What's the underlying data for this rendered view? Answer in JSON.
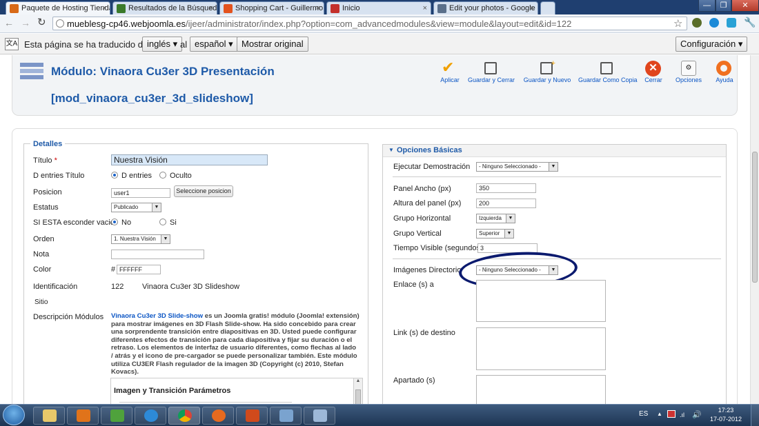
{
  "browser": {
    "tabs": [
      {
        "title": "Paquete de Hosting Tienda",
        "close": "×",
        "color": "#d86a18"
      },
      {
        "title": "Resultados de la Búsqueda",
        "close": "×",
        "color": "#3b7a2a"
      },
      {
        "title": "Shopping Cart - Guillermo",
        "close": "×",
        "color": "#e3531e"
      },
      {
        "title": "Inicio",
        "close": "×",
        "color": "#c4302b"
      },
      {
        "title": "Edit your photos - Google",
        "close": "×",
        "color": "#5a6f8a"
      }
    ],
    "url_host": "mueblesg-cp46.webjoomla.es",
    "url_path": "/ijeer/administrator/index.php?option=com_advancedmodules&view=module&layout=edit&id=122",
    "window_buttons": [
      "—",
      "❐",
      "✕"
    ]
  },
  "translate_bar": {
    "text1": "Esta página se ha traducido del",
    "from_lang": "inglés ▾",
    "text2": "al",
    "to_lang": "español ▾",
    "show_original": "Mostrar original",
    "config": "Configuración ▾"
  },
  "header": {
    "title_line1": "Módulo: Vinaora Cu3er 3D Presentación",
    "title_line2": "[mod_vinaora_cu3er_3d_slideshow]",
    "toolbar": [
      "Aplicar",
      "Guardar y Cerrar",
      "Guardar y Nuevo",
      "Guardar Como Copia",
      "Cerrar",
      "Opciones",
      "Ayuda"
    ]
  },
  "details": {
    "legend": "Detalles",
    "titulo_label": "Título",
    "titulo_required": "*",
    "titulo_value": "Nuestra Visión",
    "show_title_label": "D entries Título",
    "show_title_opt1": "D entries",
    "show_title_opt2": "Oculto",
    "posicion_label": "Posicion",
    "posicion_value": "user1",
    "posicion_button": "Seleccione posicion",
    "estatus_label": "Estatus",
    "estatus_value": "Publicado",
    "hide_label": "SI ESTA esconder vacio",
    "hide_opt1": "No",
    "hide_opt2": "Si",
    "orden_label": "Orden",
    "orden_value": "1. Nuestra Visión",
    "nota_label": "Nota",
    "nota_value": "",
    "color_label": "Color",
    "color_hash": "#",
    "color_value": "FFFFFF",
    "id_label": "Identificación",
    "id_value": "122",
    "id_name": "Vinaora Cu3er 3D Slideshow",
    "sitio_label": "Sitio",
    "desc_label": "Descripción Módulos",
    "desc_link": "Vinaora Cu3er 3D Slide-show",
    "desc_text": " es un Joomla gratis! módulo (Joomla! extensión) para mostrar imágenes en 3D Flash Slide-show. Ha sido concebido para crear una sorprendente transición entre diapositivas en 3D. Usted puede configurar diferentes efectos de transición para cada diapositiva y fijar su duración o el retraso. Los elementos de interfaz de usuario diferentes, como flechas al lado / atrás y el icono de pre-cargador se puede personalizar también. Este módulo utiliza CU3ER Flash regulador de la imagen 3D (Copyright (c) 2010, Stefan Kovacs).",
    "subheading": "Imagen y Transición Parámetros"
  },
  "options": {
    "header": "Opciones Básicas",
    "demo_label": "Ejecutar Demostración",
    "demo_value": "- Ninguno Seleccionado -",
    "width_label": "Panel Ancho (px)",
    "width_value": "350",
    "height_label": "Altura del panel (px)",
    "height_value": "200",
    "hgroup_label": "Grupo Horizontal",
    "hgroup_value": "Izquierda",
    "vgroup_label": "Grupo Vertical",
    "vgroup_value": "Superior",
    "time_label": "Tiempo Visible (segundos)",
    "time_value": "3",
    "imgdir_label": "Imágenes Directorio",
    "imgdir_value": "- Ninguno Seleccionado -",
    "links_label": "Enlace (s) a",
    "target_label": "Link (s) de destino",
    "apartado_label": "Apartado (s)"
  },
  "taskbar": {
    "lang": "ES",
    "time": "17:23",
    "date": "17-07-2012"
  },
  "colors": {
    "title_blue": "#1e5aa8",
    "link_blue": "#0b55c4",
    "highlight_circle": "#0b1a6e"
  }
}
